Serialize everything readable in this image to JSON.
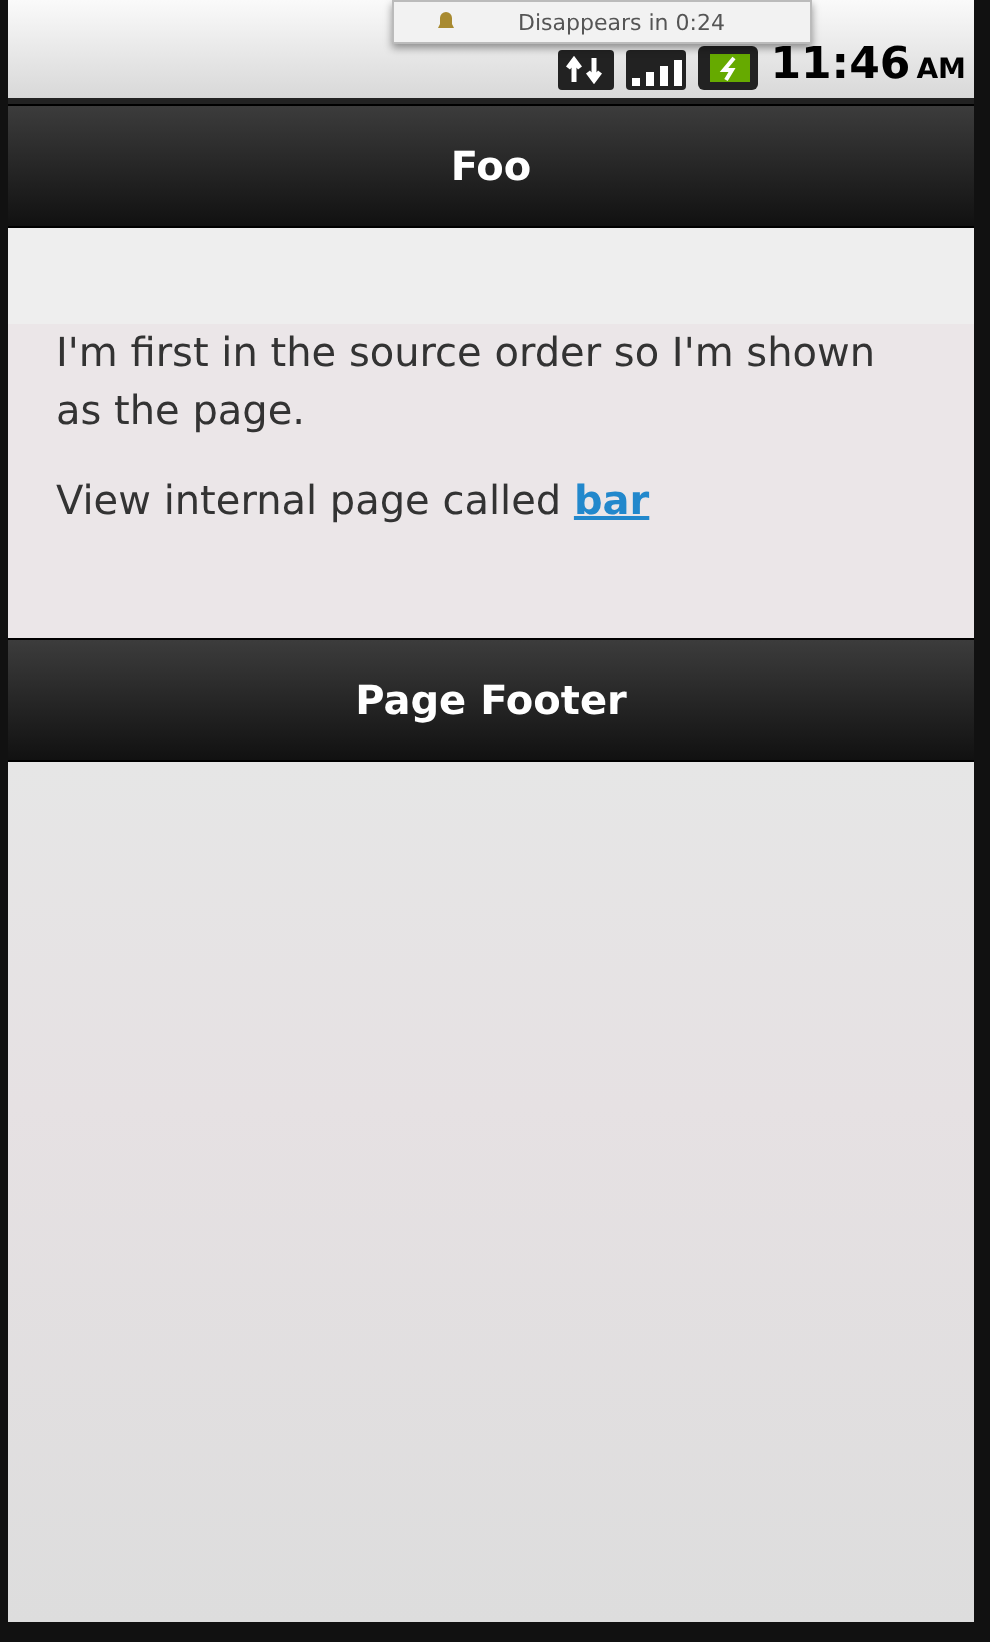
{
  "notification": {
    "text": "Disappears in 0:24"
  },
  "status_bar": {
    "time": "11:46",
    "meridiem": "AM"
  },
  "header": {
    "title": "Foo"
  },
  "content": {
    "paragraph": "I'm first in the source order so I'm shown as the page.",
    "link_prefix": "View internal page called",
    "link": "bar"
  },
  "footer": {
    "title": "Page Footer"
  }
}
